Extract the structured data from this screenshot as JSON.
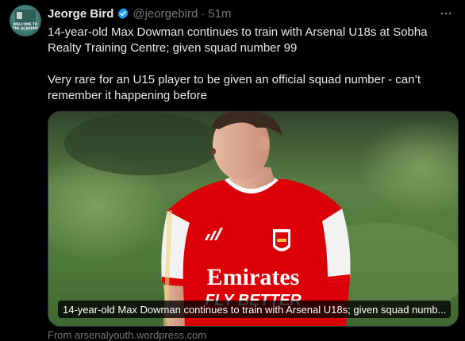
{
  "author": {
    "name": "Jeorge Bird",
    "handle": "@jeorgebird",
    "separator": "·",
    "time": "51m",
    "verified": true,
    "avatar_text": "WELCOME TO THE ACADEMY"
  },
  "tweet": {
    "paragraphs": [
      "14-year-old Max Dowman continues to train with Arsenal U18s at Sobha Realty Training Centre; given squad number 99",
      "Very rare for an U15 player to be given an official squad number - can’t remember it happening before"
    ]
  },
  "media": {
    "caption": "14-year-old Max Dowman continues to train with Arsenal U18s; given squad numb...",
    "shirt_sponsor_line1": "Emirates",
    "shirt_sponsor_line2": "FLY BETTER"
  },
  "source": {
    "text": "From arsenalyouth.wordpress.com"
  },
  "icons": {
    "verified": "verified-badge-icon",
    "more": "more-options-icon"
  },
  "colors": {
    "background": "#000000",
    "text_primary": "#e7e9ea",
    "text_secondary": "#71767b",
    "verified_blue": "#1d9bf0",
    "arsenal_red": "#db0007"
  }
}
